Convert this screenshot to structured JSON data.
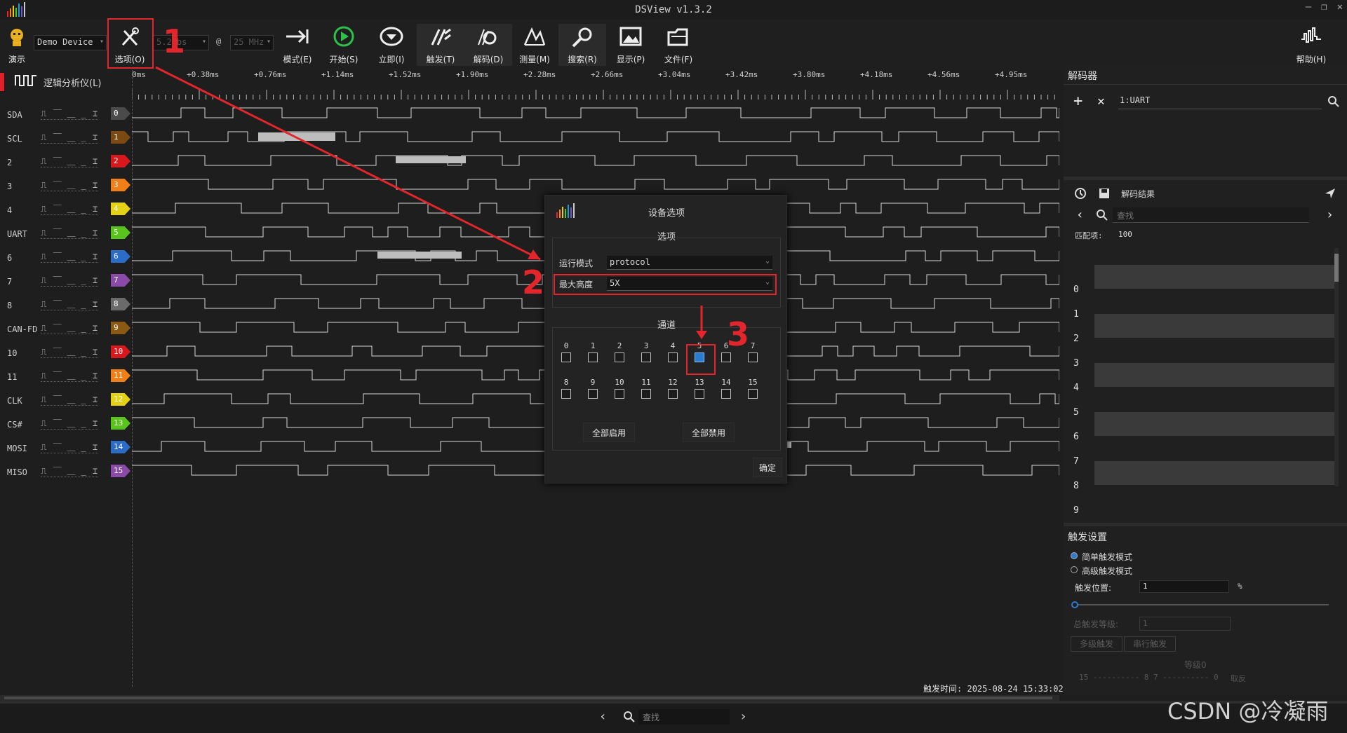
{
  "window": {
    "title": "DSView v1.3.2",
    "min": "—",
    "restore": "❐",
    "close": "✕"
  },
  "toolbar": {
    "demo_label": "演示",
    "device": "Demo Device",
    "options_label": "选项(O)",
    "depth": "5.2Mbs",
    "at": "@",
    "rate": "25 MHz",
    "mode_label": "模式(E)",
    "start_label": "开始(S)",
    "instant_label": "立即(I)",
    "trigger_label": "触发(T)",
    "decode_label": "解码(D)",
    "measure_label": "测量(M)",
    "search_label": "搜索(R)",
    "display_label": "显示(P)",
    "file_label": "文件(F)",
    "help_label": "帮助(H)"
  },
  "ruler": {
    "analyzer_label": "逻辑分析仪(L)",
    "ticks": [
      "0ms",
      "+0.38ms",
      "+0.76ms",
      "+1.14ms",
      "+1.52ms",
      "+1.90ms",
      "+2.28ms",
      "+2.66ms",
      "+3.04ms",
      "+3.42ms",
      "+3.80ms",
      "+4.18ms",
      "+4.56ms",
      "+4.95ms"
    ]
  },
  "trigger_glyphs": "⎍ ⎺ ⎽ _ ⌶",
  "channels": [
    {
      "name": "SDA",
      "idx": "0",
      "color": "#4a4a4a"
    },
    {
      "name": "SCL",
      "idx": "1",
      "color": "#7a4a12"
    },
    {
      "name": "2",
      "idx": "2",
      "color": "#d8181c"
    },
    {
      "name": "3",
      "idx": "3",
      "color": "#f07f18"
    },
    {
      "name": "4",
      "idx": "4",
      "color": "#e6d214"
    },
    {
      "name": "UART",
      "idx": "5",
      "color": "#58c41c"
    },
    {
      "name": "6",
      "idx": "6",
      "color": "#2a6cc8"
    },
    {
      "name": "7",
      "idx": "7",
      "color": "#8a4aa8"
    },
    {
      "name": "8",
      "idx": "8",
      "color": "#6a6a6a"
    },
    {
      "name": "CAN-FD",
      "idx": "9",
      "color": "#8a5a14"
    },
    {
      "name": "10",
      "idx": "10",
      "color": "#d8181c"
    },
    {
      "name": "11",
      "idx": "11",
      "color": "#f07f18"
    },
    {
      "name": "CLK",
      "idx": "12",
      "color": "#e6d214"
    },
    {
      "name": "CS#",
      "idx": "13",
      "color": "#58c41c"
    },
    {
      "name": "MOSI",
      "idx": "14",
      "color": "#2a6cc8"
    },
    {
      "name": "MISO",
      "idx": "15",
      "color": "#8a4aa8"
    }
  ],
  "decoder": {
    "title": "解码器",
    "add": "+",
    "remove": "✕",
    "selected": "1:UART",
    "results_title": "解码结果",
    "search_placeholder": "查找",
    "match_label": "匹配项:",
    "match_count": "100",
    "rows": [
      "0",
      "1",
      "2",
      "3",
      "4",
      "5",
      "6",
      "7",
      "8",
      "9"
    ]
  },
  "trigger_panel": {
    "title": "触发设置",
    "simple": "简单触发模式",
    "advanced": "高级触发模式",
    "position_label": "触发位置:",
    "position_value": "1",
    "percent": "%",
    "total_label": "总触发等级:",
    "total_value": "1",
    "tab_multi": "多级触发",
    "tab_serial": "串行触发",
    "level_label": "等级0",
    "scale_left": "15 ---------- 8 7 ---------- 0",
    "scale_right": "取反"
  },
  "dialog": {
    "title": "设备选项",
    "options_group": "选项",
    "run_mode_label": "运行模式",
    "run_mode_value": "protocol",
    "max_height_label": "最大高度",
    "max_height_value": "5X",
    "channels_group": "通道",
    "channel_nums_row1": [
      "0",
      "1",
      "2",
      "3",
      "4",
      "5",
      "6",
      "7"
    ],
    "channel_nums_row2": [
      "8",
      "9",
      "10",
      "11",
      "12",
      "13",
      "14",
      "15"
    ],
    "checked_channel": "5",
    "enable_all": "全部启用",
    "disable_all": "全部禁用",
    "ok": "确定"
  },
  "status": {
    "trigger_time_label": "触发时间:",
    "trigger_time": "2025-08-24 15:33:02"
  },
  "bottom": {
    "search_placeholder": "查找"
  },
  "annotations": {
    "n1": "1",
    "n2": "2",
    "n3": "3",
    "color": "#e4262c"
  },
  "watermark": "CSDN @冷凝雨"
}
